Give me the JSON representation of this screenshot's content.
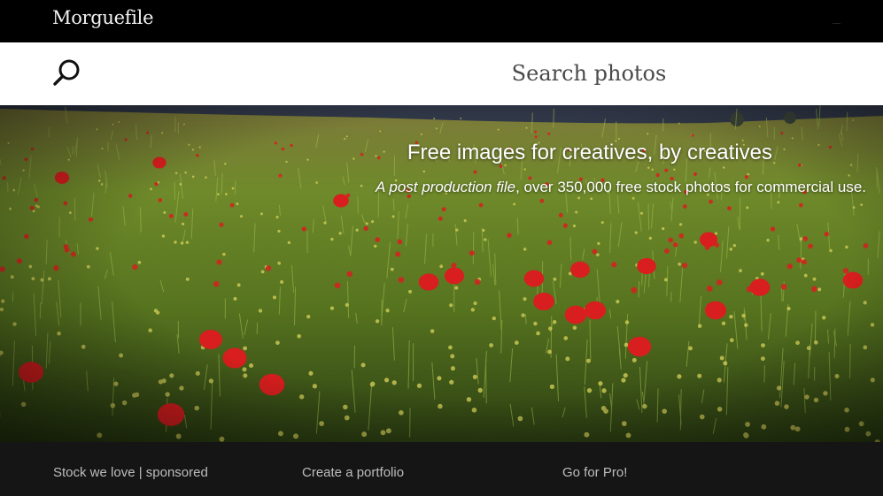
{
  "header": {
    "brand": "Morguefile"
  },
  "search": {
    "placeholder": "Search photos",
    "icon": "search-icon"
  },
  "hero": {
    "title": "Free images for creatives, by creatives",
    "subtitle_italic": "A post production file",
    "subtitle_rest": ", over 350,000 free stock photos for commercial use.",
    "image": "poppy field"
  },
  "footer": {
    "links": [
      "Stock we love | sponsored",
      "Create a portfolio",
      "Go for Pro!"
    ]
  },
  "colors": {
    "topbar": "#000000",
    "searchbar": "#ffffff",
    "footer": "#151515",
    "footer_text": "#bdbdbd",
    "poppy": "#d81e1e",
    "field_green": "#5f7a22"
  }
}
